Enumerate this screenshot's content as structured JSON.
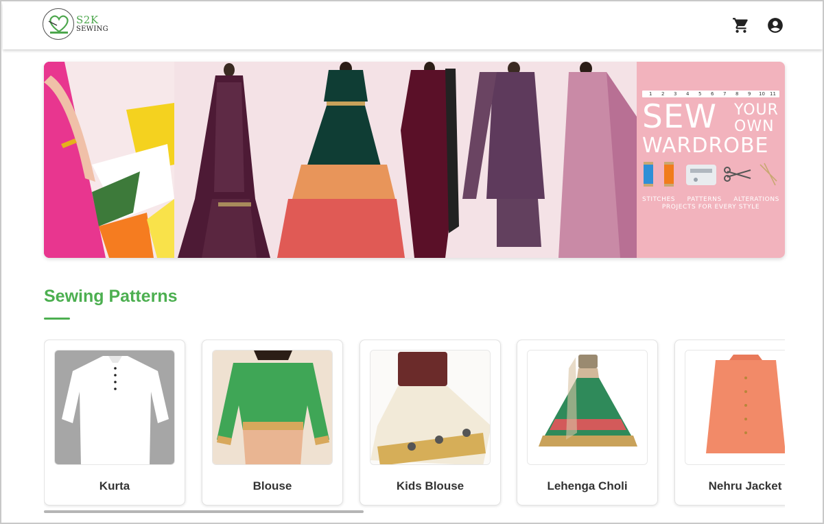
{
  "brand": {
    "logo_top": "S2K",
    "logo_bottom": "SEWING",
    "accent_color": "#4caf50"
  },
  "header": {
    "cart_icon": "shopping-cart-icon",
    "account_icon": "account-circle-icon"
  },
  "banner": {
    "ruler_numbers": [
      "1",
      "2",
      "3",
      "4",
      "5",
      "6",
      "7",
      "8",
      "9",
      "10",
      "11"
    ],
    "headline_big": "SEW",
    "headline_your": "YOUR",
    "headline_own": "OWN",
    "headline_wardrobe": "WARDROBE",
    "tag_stitches": "STITCHES",
    "tag_patterns": "PATTERNS",
    "tag_alterations": "ALTERATIONS",
    "tag_line2": "PROJECTS FOR EVERY STYLE"
  },
  "section": {
    "title": "Sewing Patterns"
  },
  "patterns": [
    {
      "label": "Kurta"
    },
    {
      "label": "Blouse"
    },
    {
      "label": "Kids Blouse"
    },
    {
      "label": "Lehenga Choli"
    },
    {
      "label": "Nehru Jacket"
    }
  ]
}
